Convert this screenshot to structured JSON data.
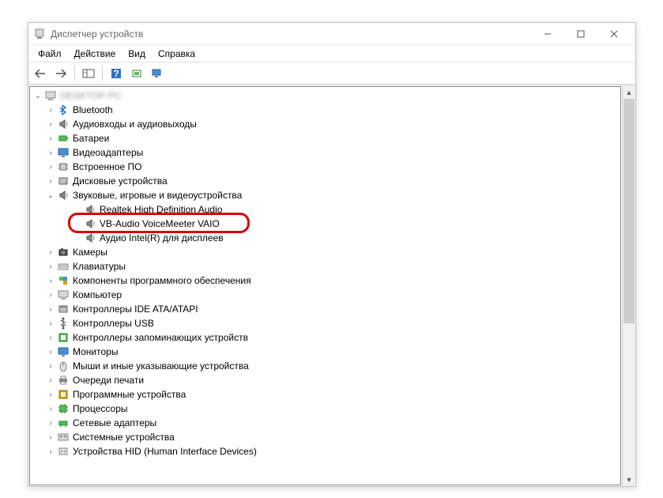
{
  "window": {
    "title": "Диспетчер устройств"
  },
  "menu": {
    "file": "Файл",
    "action": "Действие",
    "view": "Вид",
    "help": "Справка"
  },
  "tree": {
    "root": "DESKTOP-PC",
    "items": [
      {
        "label": "Bluetooth",
        "icon": "bluetooth"
      },
      {
        "label": "Аудиовходы и аудиовыходы",
        "icon": "speaker"
      },
      {
        "label": "Батареи",
        "icon": "battery"
      },
      {
        "label": "Видеоадаптеры",
        "icon": "display"
      },
      {
        "label": "Встроенное ПО",
        "icon": "chip"
      },
      {
        "label": "Дисковые устройства",
        "icon": "disk"
      },
      {
        "label": "Звуковые, игровые и видеоустройства",
        "icon": "speaker",
        "expanded": true,
        "children": [
          {
            "label": "Realtek High Definition Audio",
            "icon": "speaker"
          },
          {
            "label": "VB-Audio VoiceMeeter VAIO",
            "icon": "speaker",
            "highlighted": true
          },
          {
            "label": "Аудио Intel(R) для дисплеев",
            "icon": "speaker"
          }
        ]
      },
      {
        "label": "Камеры",
        "icon": "camera"
      },
      {
        "label": "Клавиатуры",
        "icon": "keyboard"
      },
      {
        "label": "Компоненты программного обеспечения",
        "icon": "component"
      },
      {
        "label": "Компьютер",
        "icon": "computer"
      },
      {
        "label": "Контроллеры IDE ATA/ATAPI",
        "icon": "ide"
      },
      {
        "label": "Контроллеры USB",
        "icon": "usb"
      },
      {
        "label": "Контроллеры запоминающих устройств",
        "icon": "storage"
      },
      {
        "label": "Мониторы",
        "icon": "monitor"
      },
      {
        "label": "Мыши и иные указывающие устройства",
        "icon": "mouse"
      },
      {
        "label": "Очереди печати",
        "icon": "printer"
      },
      {
        "label": "Программные устройства",
        "icon": "software"
      },
      {
        "label": "Процессоры",
        "icon": "cpu"
      },
      {
        "label": "Сетевые адаптеры",
        "icon": "network"
      },
      {
        "label": "Системные устройства",
        "icon": "system"
      },
      {
        "label": "Устройства HID (Human Interface Devices)",
        "icon": "hid"
      }
    ]
  }
}
